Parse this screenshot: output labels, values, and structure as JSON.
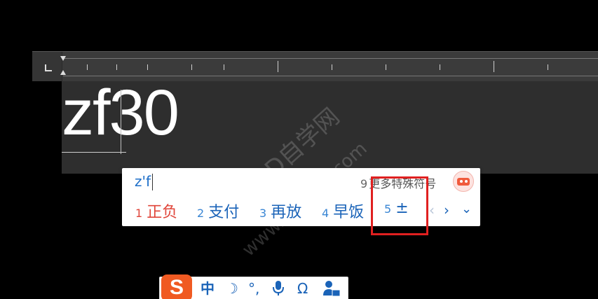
{
  "editor": {
    "text": "zf30"
  },
  "watermark": {
    "line1": "CAD自学网",
    "line2": "www.cadzxw.com"
  },
  "ime": {
    "input": "z'f",
    "more_symbols": {
      "num": "9",
      "label": "更多特殊符号"
    },
    "candidates": [
      {
        "num": "1",
        "word": "正负"
      },
      {
        "num": "2",
        "word": "支付"
      },
      {
        "num": "3",
        "word": "再放"
      },
      {
        "num": "4",
        "word": "早饭"
      },
      {
        "num": "5",
        "word": "±"
      }
    ],
    "page_prev": "‹",
    "page_next": "›",
    "expand": "⌄"
  },
  "ime_bar": {
    "logo": "S",
    "lang": "中",
    "moon": "☽",
    "punct": "°,",
    "omega": "Ω"
  },
  "colors": {
    "accent_blue": "#1a63b8",
    "first_candidate_red": "#e0453a",
    "highlight_red": "#e02020",
    "sogou_orange": "#f05a22"
  }
}
